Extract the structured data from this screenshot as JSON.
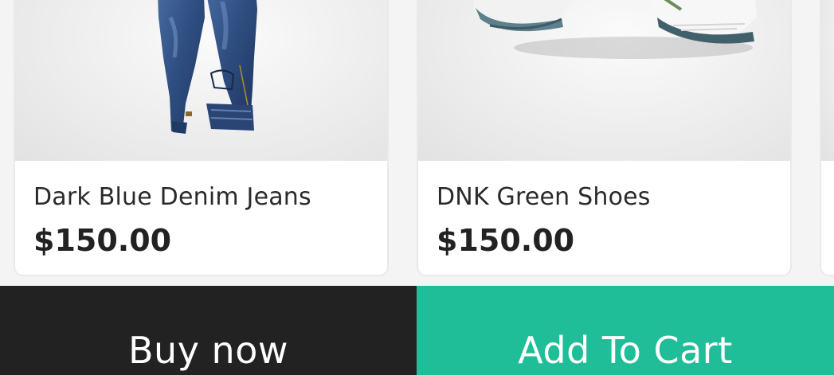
{
  "products": [
    {
      "name": "Dark Blue Denim Jeans",
      "price": "$150.00",
      "image_icon": "jeans-image"
    },
    {
      "name": "DNK Green Shoes",
      "price": "$150.00",
      "image_icon": "shoes-image"
    }
  ],
  "actions": {
    "buy_now": "Buy now",
    "add_to_cart": "Add To Cart"
  },
  "colors": {
    "buy_now_bg": "#222222",
    "add_to_cart_bg": "#1fbe98",
    "page_bg": "#f4f4f4"
  }
}
